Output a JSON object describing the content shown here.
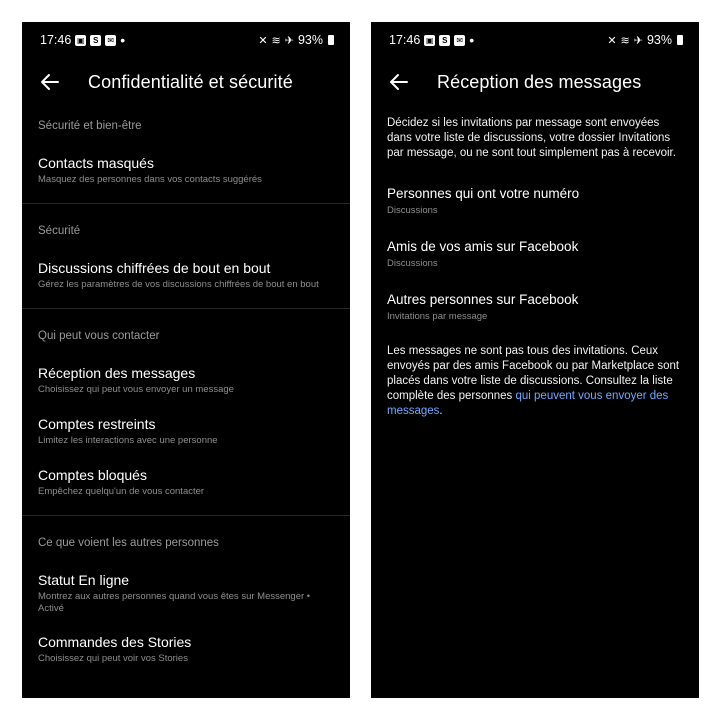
{
  "left": {
    "status": {
      "time": "17:46",
      "battery": "93%"
    },
    "header": {
      "title": "Confidentialité et sécurité"
    },
    "sections": [
      {
        "title": "Sécurité et bien-être",
        "items": [
          {
            "title": "Contacts masqués",
            "subtitle": "Masquez des personnes dans vos contacts suggérés"
          }
        ]
      },
      {
        "title": "Sécurité",
        "items": [
          {
            "title": "Discussions chiffrées de bout en bout",
            "subtitle": "Gérez les paramètres de vos discussions chiffrées de bout en bout"
          }
        ]
      },
      {
        "title": "Qui peut vous contacter",
        "items": [
          {
            "title": "Réception des messages",
            "subtitle": "Choisissez qui peut vous envoyer un message"
          },
          {
            "title": "Comptes restreints",
            "subtitle": "Limitez les interactions avec une personne"
          },
          {
            "title": "Comptes bloqués",
            "subtitle": "Empêchez quelqu'un de vous contacter"
          }
        ]
      },
      {
        "title": "Ce que voient les autres personnes",
        "items": [
          {
            "title": "Statut En ligne",
            "subtitle": "Montrez aux autres personnes quand vous êtes sur Messenger • Activé"
          },
          {
            "title": "Commandes des Stories",
            "subtitle": "Choisissez qui peut voir vos Stories"
          }
        ]
      }
    ]
  },
  "right": {
    "status": {
      "time": "17:46",
      "battery": "93%"
    },
    "header": {
      "title": "Réception des messages"
    },
    "intro": "Décidez si les invitations par message sont envoyées dans votre liste de discussions, votre dossier Invitations par message, ou ne sont tout simplement pas à recevoir.",
    "options": [
      {
        "title": "Personnes qui ont votre numéro",
        "subtitle": "Discussions"
      },
      {
        "title": "Amis de vos amis sur Facebook",
        "subtitle": "Discussions"
      },
      {
        "title": "Autres personnes sur Facebook",
        "subtitle": "Invitations par message"
      }
    ],
    "footer": {
      "text": "Les messages ne sont pas tous des invitations. Ceux envoyés par des amis Facebook ou par Marketplace sont placés dans votre liste de discussions. Consultez la liste complète des personnes ",
      "link": "qui peuvent vous envoyer des messages",
      "end": "."
    }
  }
}
